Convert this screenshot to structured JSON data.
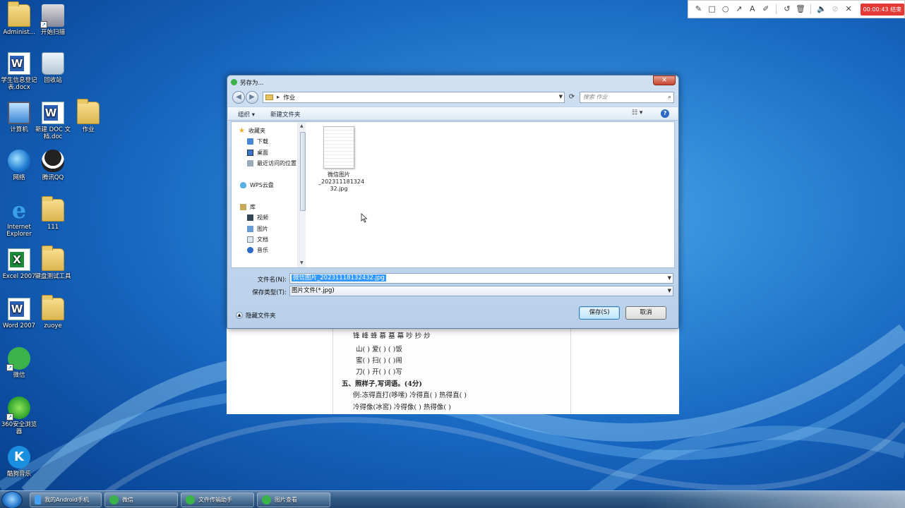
{
  "desktop": {
    "icons": [
      {
        "label": "Administ...",
        "icon": "folder-icon"
      },
      {
        "label": "开始扫描",
        "icon": "scanner-icon"
      },
      {
        "label": "学生信息登记表.docx",
        "icon": "word-doc-icon"
      },
      {
        "label": "回收站",
        "icon": "recycle-bin-icon"
      },
      {
        "label": "计算机",
        "icon": "computer-icon"
      },
      {
        "label": "新建 DOC 文档.doc",
        "icon": "word-doc-icon"
      },
      {
        "label": "作业",
        "icon": "folder-icon"
      },
      {
        "label": "网络",
        "icon": "network-icon"
      },
      {
        "label": "腾讯QQ",
        "icon": "qq-icon"
      },
      {
        "label": "Internet Explorer",
        "icon": "ie-icon"
      },
      {
        "label": "111",
        "icon": "folder-icon"
      },
      {
        "label": "Excel 2007",
        "icon": "excel-icon"
      },
      {
        "label": "键盘测试工具",
        "icon": "folder-icon"
      },
      {
        "label": "Word 2007",
        "icon": "word-icon"
      },
      {
        "label": "zuoye",
        "icon": "folder-icon"
      },
      {
        "label": "微信",
        "icon": "wechat-icon"
      },
      {
        "label": "360安全浏览器",
        "icon": "360-browser-icon"
      },
      {
        "label": "酷狗音乐",
        "icon": "kugou-icon"
      }
    ]
  },
  "recorder": {
    "timer": "00:00:43 结束"
  },
  "dialog": {
    "title": "另存为...",
    "close_label": "✕",
    "address": "作业",
    "search_placeholder": "搜索 作业",
    "toolbar": {
      "organize": "组织 ▾",
      "new_folder": "新建文件夹"
    },
    "nav": {
      "favorites": "收藏夹",
      "downloads": "下载",
      "desktop": "桌面",
      "recent": "最近访问的位置",
      "wps_cloud": "WPS云盘",
      "libraries": "库",
      "videos": "视频",
      "pictures": "图片",
      "documents": "文档",
      "music": "音乐"
    },
    "file": {
      "name_line1": "微信图片",
      "name_line2": "_202311181324",
      "name_line3": "32.jpg"
    },
    "filename_label": "文件名(N):",
    "filename_value": "微信图片_20231118132432.jpg",
    "filetype_label": "保存类型(T):",
    "filetype_value": "图片文件(*.jpg)",
    "hide_folders": "隐藏文件夹",
    "save_button": "保存(S)",
    "cancel_button": "取消"
  },
  "document": {
    "lines": [
      "锋  峰  蜂              慕  墓  幕            吵  抄  炒",
      "山(     )           爱(     )          (    )饭",
      "蜜(     )           扫(     )          (    )闹",
      "刀(     )           开(     )          (    )写",
      "五、照样子,写词语。(4分)",
      "例:冻得直打(哆嗦)     冷得直(         )    热得直(         )",
      "冷得像(冰窖)          冷得像(         )    热得像(         )"
    ]
  },
  "taskbar": {
    "items": [
      {
        "label": "我的Android手机"
      },
      {
        "label": "微信"
      },
      {
        "label": "文件传输助手"
      },
      {
        "label": "图片查看"
      }
    ]
  }
}
